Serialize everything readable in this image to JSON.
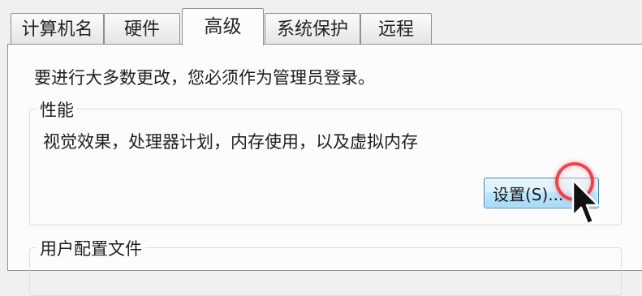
{
  "tabs": [
    {
      "label": "计算机名",
      "active": false
    },
    {
      "label": "硬件",
      "active": false
    },
    {
      "label": "高级",
      "active": true
    },
    {
      "label": "系统保护",
      "active": false
    },
    {
      "label": "远程",
      "active": false
    }
  ],
  "main": {
    "intro": "要进行大多数更改，您必须作为管理员登录。",
    "performance": {
      "title": "性能",
      "description": "视觉效果，处理器计划，内存使用，以及虚拟内存",
      "settings_button": "设置(S)..."
    },
    "user_profiles": {
      "title": "用户配置文件"
    }
  },
  "colors": {
    "button_border": "#3c7fb1",
    "click_indicator": "#e42832"
  },
  "icons": {
    "cursor": "mouse-pointer-icon"
  }
}
